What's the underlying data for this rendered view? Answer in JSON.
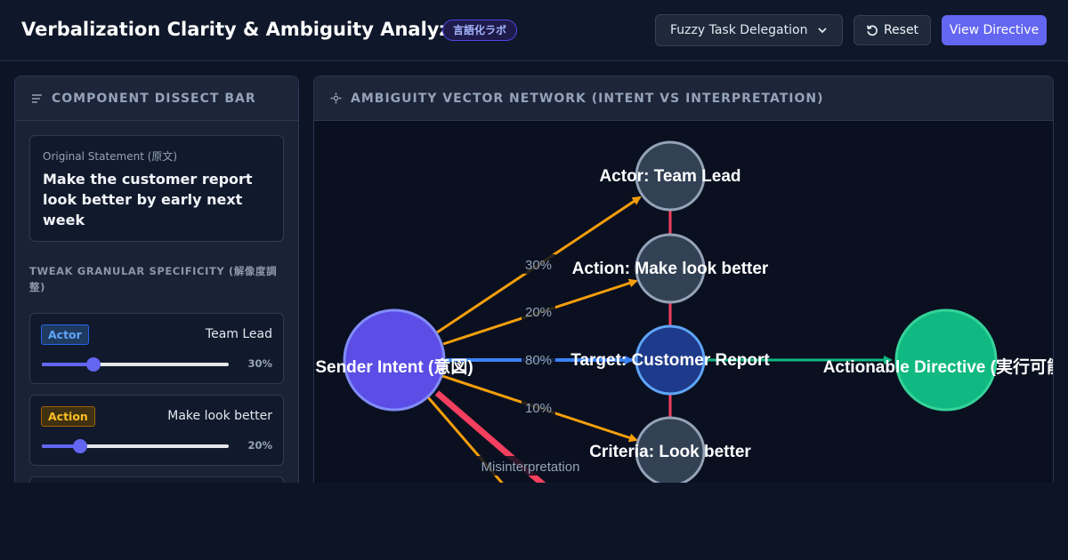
{
  "header": {
    "title": "Verbalization Clarity & Ambiguity Analyzer",
    "badge": "言語化ラボ",
    "scenario_selected": "Fuzzy Task Delegation",
    "reset_label": "Reset",
    "view_label": "View Directive",
    "accent_color": "#6366f1"
  },
  "left_panel": {
    "title": "COMPONENT DISSECT BAR",
    "statement_label": "Original Statement (原文)",
    "statement_text": "Make the customer report look better by early next week",
    "tweak_heading": "TWEAK GRANULAR SPECIFICITY (解像度調整)",
    "components": [
      {
        "tag": "Actor",
        "value": "Team Lead",
        "percent_label": "30%",
        "level": 0.3
      },
      {
        "tag": "Action",
        "value": "Make look better",
        "percent_label": "20%",
        "level": 0.2
      }
    ]
  },
  "right_panel": {
    "title": "AMBIGUITY VECTOR NETWORK (INTENT VS INTERPRETATION)",
    "nodes": {
      "sender": "Sender Intent (意図)",
      "actor": "Actor: Team Lead",
      "action": "Action: Make look better",
      "target": "Target: Customer Report",
      "criteria": "Criteria: Look better",
      "directive": "Actionable Directive (実行可能)"
    },
    "edges": {
      "actor_pct": "30%",
      "action_pct": "20%",
      "target_pct": "80%",
      "criteria_pct": "10%",
      "misinterpretation": "Misinterpretation"
    },
    "colors": {
      "sender": "#5b4de6",
      "component": "#334155",
      "target": "#1e3a8a",
      "directive": "#10b981",
      "weak_edge": "#f59e0b",
      "strong_edge": "#3b82f6",
      "misinterpretation_edge": "#f43f5e"
    }
  }
}
